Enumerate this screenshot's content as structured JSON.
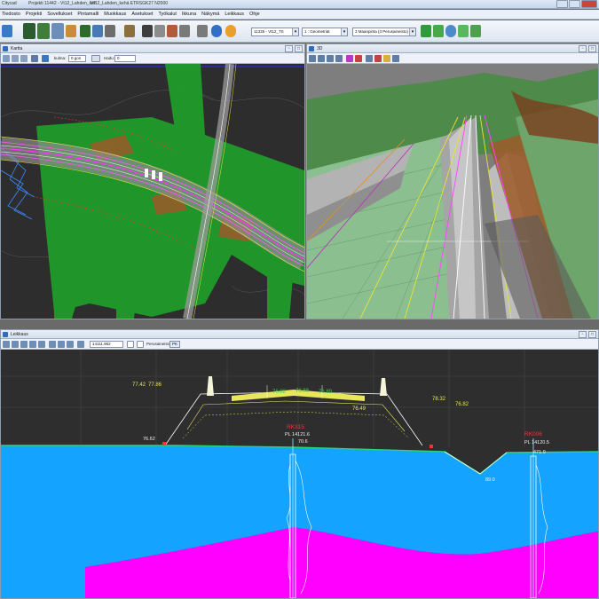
{
  "app": {
    "name": "Citycad",
    "title_project": "Projekti 11442 - Vt12_Lahden_keh",
    "title_file": "Vt12_Lahden_kehä ETRSGK27 N2000"
  },
  "menu": [
    "Tiedosto",
    "Projekti",
    "Sovellukset",
    "Pintamalli",
    "Muokkaus",
    "Asetukset",
    "Työkalut",
    "Ikkuna",
    "Näkymä",
    "Leikkaus",
    "Ohje"
  ],
  "toolbar": {
    "model_select": "11335 - Vt12_TS",
    "layer_select": "1 : Geometriat",
    "surface_select": "3 Maanpinta (3 Perusaineisto)"
  },
  "map_panel": {
    "title": "Kartta",
    "rotation_label": "kulma:",
    "rotation_value": "0 gon",
    "zoom_label": "Hadu:",
    "zoom_value": "0"
  },
  "view3d_panel": {
    "title": "3D"
  },
  "section_panel": {
    "title": "Leikkaus",
    "station_value": "14111.962",
    "perus_label": "Perusaineisto",
    "pk_button": "PK"
  },
  "profile_labels": {
    "left_elev_1": "77.42",
    "left_elev_2": "77.86",
    "right_elev_1": "78.32",
    "right_elev_2": "76.82",
    "road_left": "76.88",
    "road_center": "76.88",
    "road_right": "76.89",
    "road_low": "76.49",
    "left_marker": "76.62",
    "center_red": "RK315",
    "center_pl": "PL 14121.6",
    "center_depth": "70.6",
    "right_red": "RK006",
    "right_pl": "PL 14120.5",
    "right_depth": "471.9",
    "ditch_label": "89.0"
  },
  "colors": {
    "water": "#14a3ff",
    "bedrock": "#ff00ff",
    "background": "#2e2e2e",
    "grass": "#1fbf2e",
    "road": "#8c8c8c"
  }
}
